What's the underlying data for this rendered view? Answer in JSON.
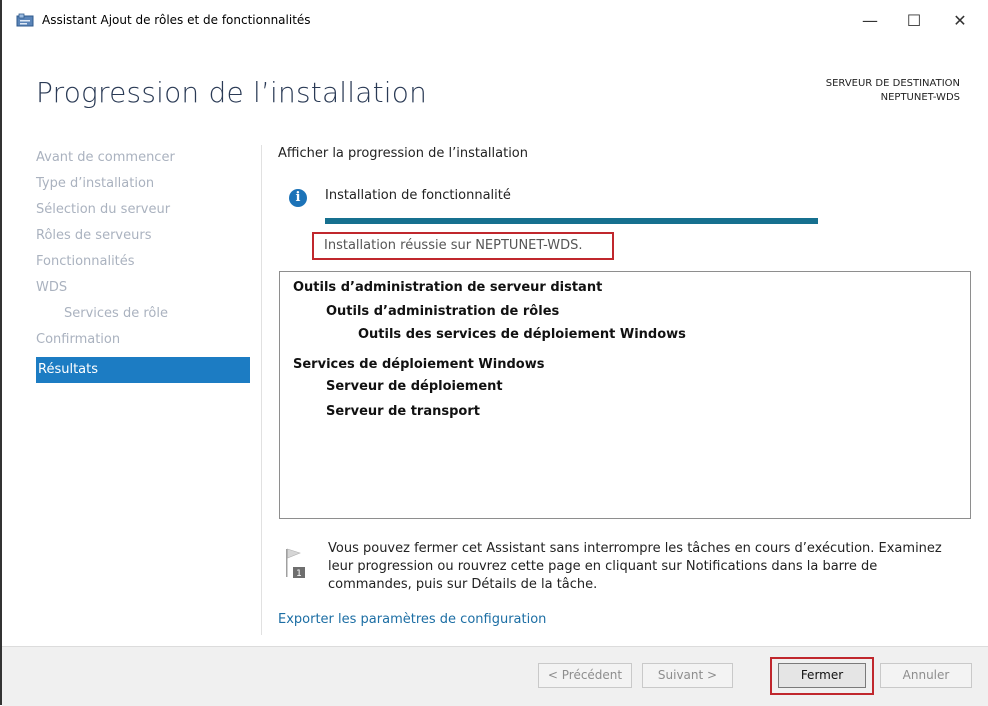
{
  "window": {
    "title": "Assistant Ajout de rôles et de fonctionnalités",
    "minimize": "—",
    "maximize": "☐",
    "close": "✕"
  },
  "page_title": "Progression de l’installation",
  "destination": {
    "label": "SERVEUR DE DESTINATION",
    "server": "NEPTUNET-WDS"
  },
  "sidebar": {
    "items": [
      {
        "label": "Avant de commencer"
      },
      {
        "label": "Type d’installation"
      },
      {
        "label": "Sélection du serveur"
      },
      {
        "label": "Rôles de serveurs"
      },
      {
        "label": "Fonctionnalités"
      },
      {
        "label": "WDS"
      },
      {
        "label": "Services de rôle"
      },
      {
        "label": "Confirmation"
      },
      {
        "label": "Résultats"
      }
    ]
  },
  "main": {
    "heading": "Afficher la progression de l’installation",
    "status_title": "Installation de fonctionnalité",
    "progress": 1.0,
    "success_message": "Installation réussie sur NEPTUNET-WDS.",
    "results": [
      {
        "label": "Outils d’administration de serveur distant",
        "level": 0
      },
      {
        "label": "Outils d’administration de rôles",
        "level": 1
      },
      {
        "label": "Outils des services de déploiement Windows",
        "level": 2
      },
      {
        "label": "Services de déploiement Windows",
        "level": 0
      },
      {
        "label": "Serveur de déploiement",
        "level": 1
      },
      {
        "label": "Serveur de transport",
        "level": 1
      }
    ],
    "note": "Vous pouvez fermer cet Assistant sans interrompre les tâches en cours d’exécution. Examinez leur progression ou rouvrez cette page en cliquant sur Notifications dans la barre de commandes, puis sur Détails de la tâche.",
    "export_link": "Exporter les paramètres de configuration"
  },
  "footer": {
    "prev": "< Précédent",
    "next": "Suivant >",
    "close": "Fermer",
    "cancel": "Annuler"
  },
  "colors": {
    "accent": "#1c7cc3",
    "progress": "#16708f",
    "highlight": "#c0272d"
  }
}
